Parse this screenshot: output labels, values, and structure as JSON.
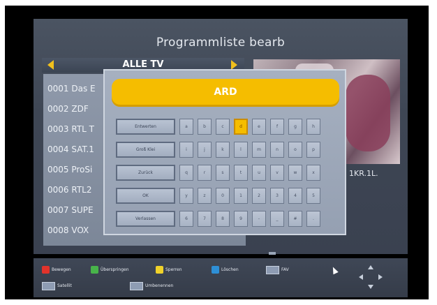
{
  "header": {
    "title": "Programmliste bearb",
    "tab_label": "ALLE TV"
  },
  "channels": [
    "0001 Das E",
    "0002 ZDF",
    "0003 RTL T",
    "0004 SAT.1",
    "0005 ProSi",
    "0006 RTL2",
    "0007 SUPE",
    "0008 VOX"
  ],
  "preview_info": "1KR.1L.",
  "keyboard": {
    "name_value": "ARD",
    "functions": [
      "Entwerten",
      "Groß Klei",
      "Zurück",
      "OK",
      "Verlassen"
    ],
    "rows": [
      [
        "a",
        "b",
        "c",
        "d",
        "e",
        "f",
        "g",
        "h"
      ],
      [
        "i",
        "j",
        "k",
        "l",
        "m",
        "n",
        "o",
        "p"
      ],
      [
        "q",
        "r",
        "s",
        "t",
        "u",
        "v",
        "w",
        "x"
      ],
      [
        "y",
        "z",
        "0",
        "1",
        "2",
        "3",
        "4",
        "5"
      ],
      [
        "6",
        "7",
        "8",
        "9",
        "-",
        "_",
        "#",
        "."
      ]
    ],
    "selected": "d"
  },
  "legend": {
    "red": "Bewegen",
    "green": "Überspringen",
    "yellow": "Sperren",
    "blue": "Löschen",
    "fav": "FAV",
    "satellit": "Satellit",
    "rename": "Umbenennen"
  },
  "colors": {
    "red": "#e2332b",
    "green": "#48b44a",
    "yellow": "#f0d22a",
    "blue": "#2e8fd6",
    "accent": "#f5bd00"
  }
}
